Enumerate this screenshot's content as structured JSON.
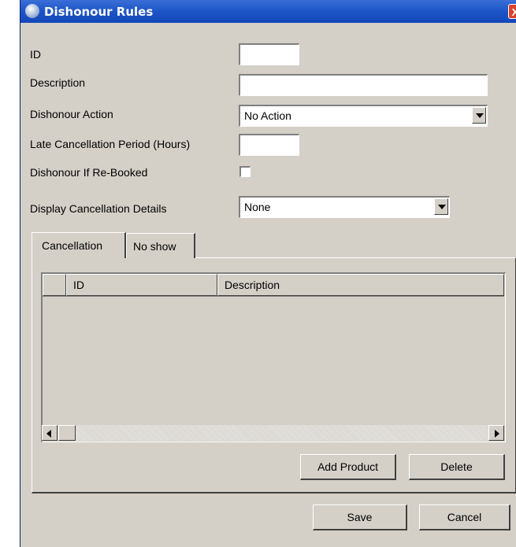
{
  "window": {
    "title": "Dishonour Rules",
    "close_label": "X"
  },
  "form": {
    "id_label": "ID",
    "id_value": "",
    "description_label": "Description",
    "description_value": "",
    "dishonour_action_label": "Dishonour Action",
    "dishonour_action_value": "No Action",
    "late_cancellation_label": "Late Cancellation Period (Hours)",
    "late_cancellation_value": "",
    "rebooked_label": "Dishonour If Re-Booked",
    "rebooked_checked": false,
    "display_details_label": "Display Cancellation Details",
    "display_details_value": "None"
  },
  "tabs": [
    {
      "label": "Cancellation",
      "active": true
    },
    {
      "label": "No show",
      "active": false
    }
  ],
  "grid": {
    "columns": [
      "",
      "ID",
      "Description"
    ],
    "rows": []
  },
  "buttons": {
    "add_product": "Add Product",
    "delete": "Delete",
    "save": "Save",
    "cancel": "Cancel"
  }
}
